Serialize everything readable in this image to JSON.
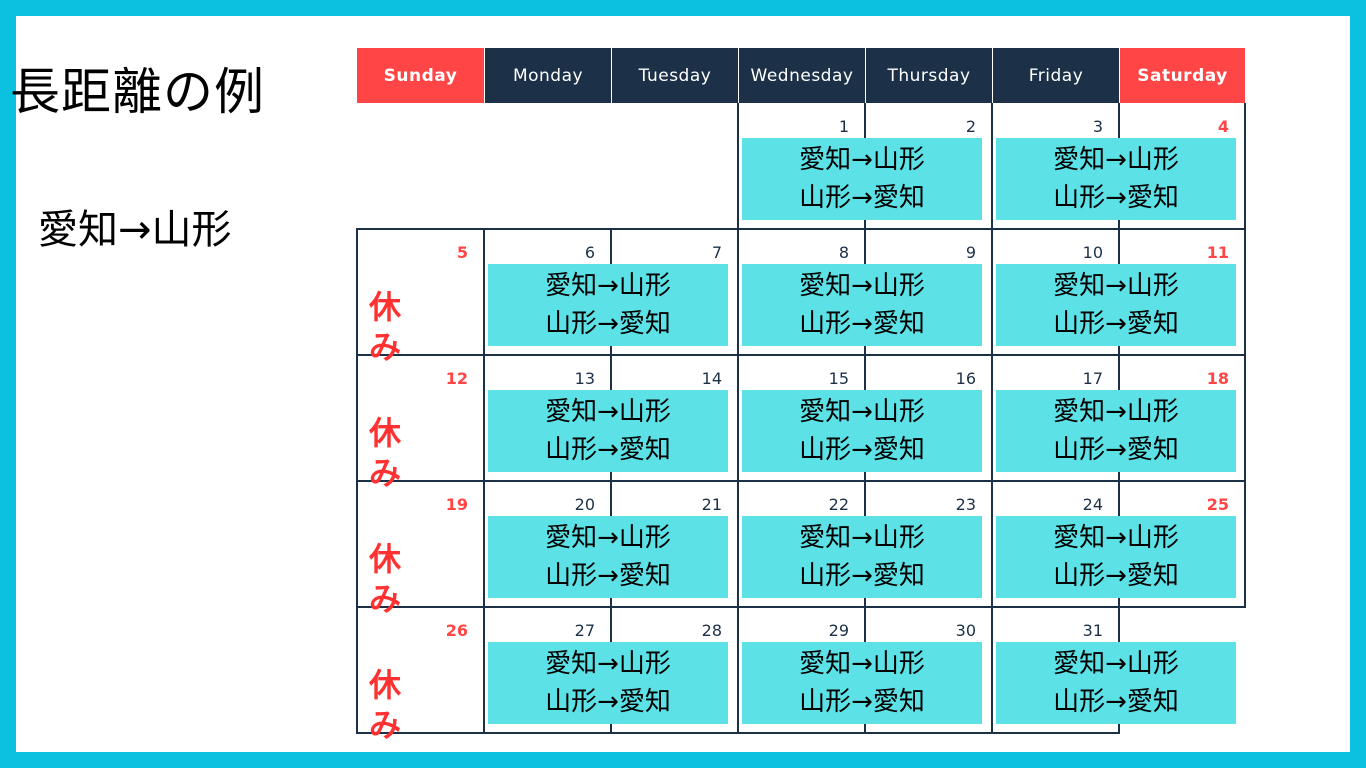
{
  "title": "長距離の例",
  "route_label": "愛知→山形",
  "weekdays": [
    {
      "label": "Sunday",
      "weekend": true
    },
    {
      "label": "Monday",
      "weekend": false
    },
    {
      "label": "Tuesday",
      "weekend": false
    },
    {
      "label": "Wednesday",
      "weekend": false
    },
    {
      "label": "Thursday",
      "weekend": false
    },
    {
      "label": "Friday",
      "weekend": false
    },
    {
      "label": "Saturday",
      "weekend": true
    }
  ],
  "days": [
    {
      "n": "1",
      "w": 3,
      "r": 0,
      "red": false
    },
    {
      "n": "2",
      "w": 4,
      "r": 0,
      "red": false
    },
    {
      "n": "3",
      "w": 5,
      "r": 0,
      "red": false
    },
    {
      "n": "4",
      "w": 6,
      "r": 0,
      "red": true
    },
    {
      "n": "5",
      "w": 0,
      "r": 1,
      "red": true
    },
    {
      "n": "6",
      "w": 1,
      "r": 1,
      "red": false
    },
    {
      "n": "7",
      "w": 2,
      "r": 1,
      "red": false
    },
    {
      "n": "8",
      "w": 3,
      "r": 1,
      "red": false
    },
    {
      "n": "9",
      "w": 4,
      "r": 1,
      "red": false
    },
    {
      "n": "10",
      "w": 5,
      "r": 1,
      "red": false
    },
    {
      "n": "11",
      "w": 6,
      "r": 1,
      "red": true
    },
    {
      "n": "12",
      "w": 0,
      "r": 2,
      "red": true
    },
    {
      "n": "13",
      "w": 1,
      "r": 2,
      "red": false
    },
    {
      "n": "14",
      "w": 2,
      "r": 2,
      "red": false
    },
    {
      "n": "15",
      "w": 3,
      "r": 2,
      "red": false
    },
    {
      "n": "16",
      "w": 4,
      "r": 2,
      "red": false
    },
    {
      "n": "17",
      "w": 5,
      "r": 2,
      "red": false
    },
    {
      "n": "18",
      "w": 6,
      "r": 2,
      "red": true
    },
    {
      "n": "19",
      "w": 0,
      "r": 3,
      "red": true
    },
    {
      "n": "20",
      "w": 1,
      "r": 3,
      "red": false
    },
    {
      "n": "21",
      "w": 2,
      "r": 3,
      "red": false
    },
    {
      "n": "22",
      "w": 3,
      "r": 3,
      "red": false
    },
    {
      "n": "23",
      "w": 4,
      "r": 3,
      "red": false
    },
    {
      "n": "24",
      "w": 5,
      "r": 3,
      "red": false
    },
    {
      "n": "25",
      "w": 6,
      "r": 3,
      "red": true
    },
    {
      "n": "26",
      "w": 0,
      "r": 4,
      "red": true
    },
    {
      "n": "27",
      "w": 1,
      "r": 4,
      "red": false
    },
    {
      "n": "28",
      "w": 2,
      "r": 4,
      "red": false
    },
    {
      "n": "29",
      "w": 3,
      "r": 4,
      "red": false
    },
    {
      "n": "30",
      "w": 4,
      "r": 4,
      "red": false
    },
    {
      "n": "31",
      "w": 5,
      "r": 4,
      "red": false
    }
  ],
  "trips": [
    {
      "w": 3,
      "r": 0,
      "outbound": "愛知→山形",
      "return": "山形→愛知"
    },
    {
      "w": 5,
      "r": 0,
      "outbound": "愛知→山形",
      "return": "山形→愛知"
    },
    {
      "w": 1,
      "r": 1,
      "outbound": "愛知→山形",
      "return": "山形→愛知"
    },
    {
      "w": 3,
      "r": 1,
      "outbound": "愛知→山形",
      "return": "山形→愛知"
    },
    {
      "w": 5,
      "r": 1,
      "outbound": "愛知→山形",
      "return": "山形→愛知"
    },
    {
      "w": 1,
      "r": 2,
      "outbound": "愛知→山形",
      "return": "山形→愛知"
    },
    {
      "w": 3,
      "r": 2,
      "outbound": "愛知→山形",
      "return": "山形→愛知"
    },
    {
      "w": 5,
      "r": 2,
      "outbound": "愛知→山形",
      "return": "山形→愛知"
    },
    {
      "w": 1,
      "r": 3,
      "outbound": "愛知→山形",
      "return": "山形→愛知"
    },
    {
      "w": 3,
      "r": 3,
      "outbound": "愛知→山形",
      "return": "山形→愛知"
    },
    {
      "w": 5,
      "r": 3,
      "outbound": "愛知→山形",
      "return": "山形→愛知"
    },
    {
      "w": 1,
      "r": 4,
      "outbound": "愛知→山形",
      "return": "山形→愛知"
    },
    {
      "w": 3,
      "r": 4,
      "outbound": "愛知→山形",
      "return": "山形→愛知"
    },
    {
      "w": 5,
      "r": 4,
      "outbound": "愛知→山形",
      "return": "山形→愛知"
    }
  ],
  "rest_days": [
    {
      "r": 1,
      "label": "休み"
    },
    {
      "r": 2,
      "label": "休み"
    },
    {
      "r": 3,
      "label": "休み"
    },
    {
      "r": 4,
      "label": "休み"
    }
  ]
}
